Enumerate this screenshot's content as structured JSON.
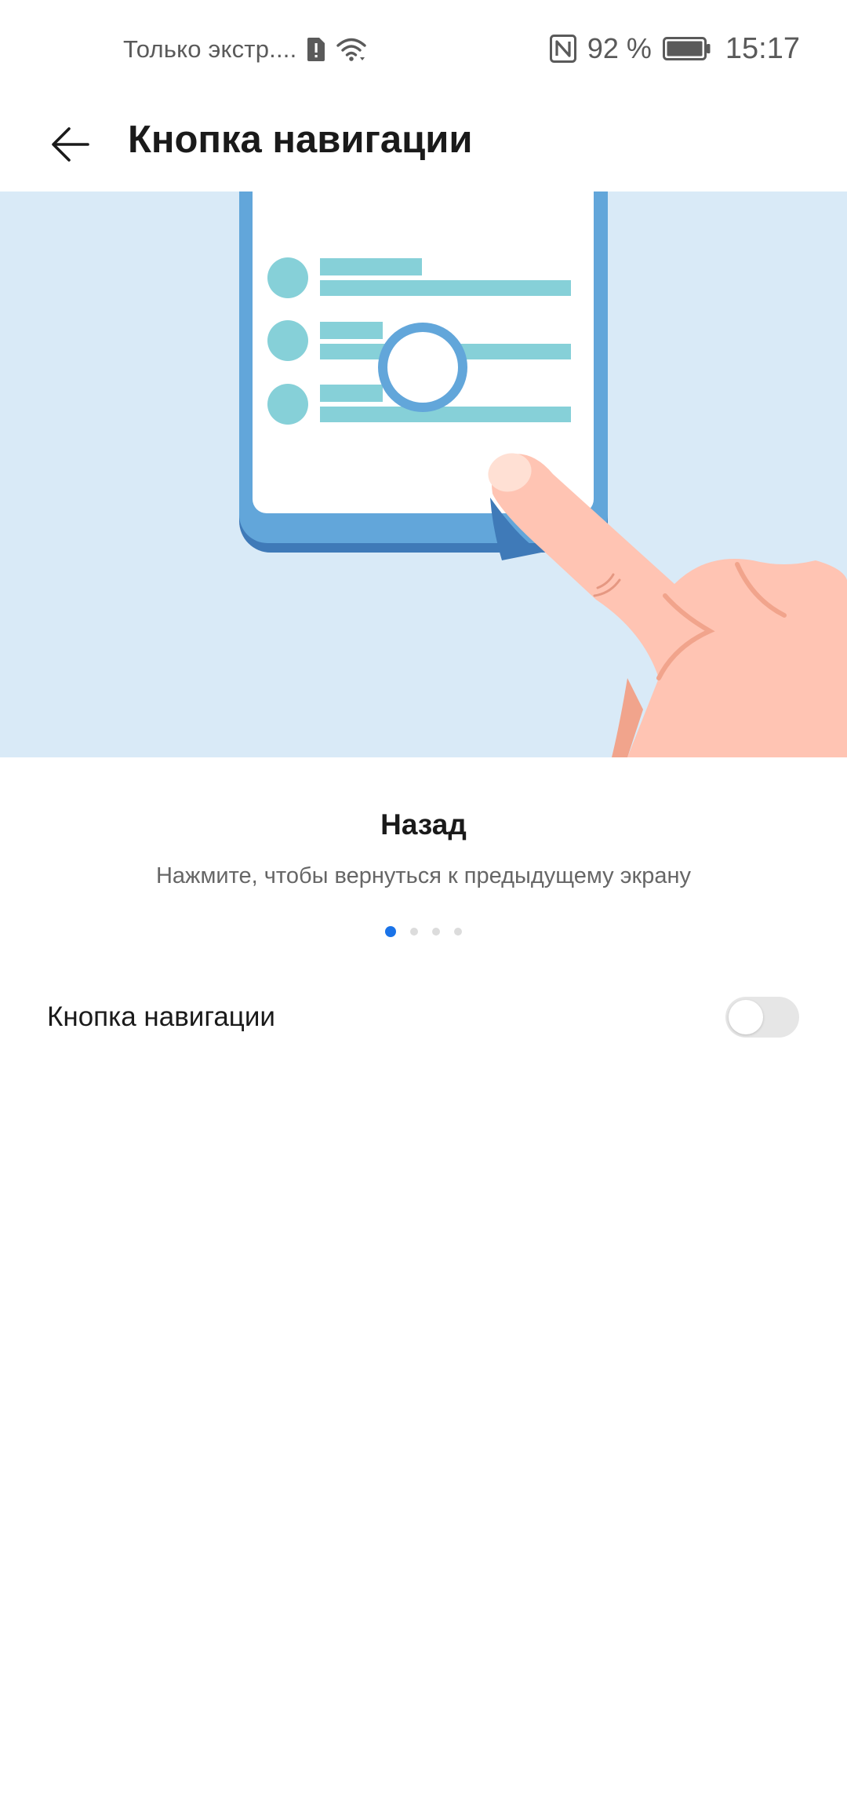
{
  "status_bar": {
    "carrier_text": "Только экстр....",
    "battery_percent": "92 %",
    "time": "15:17",
    "icons": [
      "sim-alert-icon",
      "wifi-icon",
      "nfc-icon",
      "battery-icon"
    ]
  },
  "app_bar": {
    "back_icon": "arrow-left-icon",
    "title": "Кнопка навигации"
  },
  "tutorial": {
    "title": "Назад",
    "description": "Нажмите, чтобы вернуться к предыдущему экрану",
    "page_count": 4,
    "current_page": 1
  },
  "settings": {
    "nav_button": {
      "label": "Кнопка навигации",
      "enabled": false
    }
  },
  "colors": {
    "accent": "#1a73e8",
    "illustration_bg": "#d9eaf7",
    "phone_frame": "#5aa0d8",
    "list_item": "#86d0d8",
    "hand": "#ffc4b3"
  }
}
